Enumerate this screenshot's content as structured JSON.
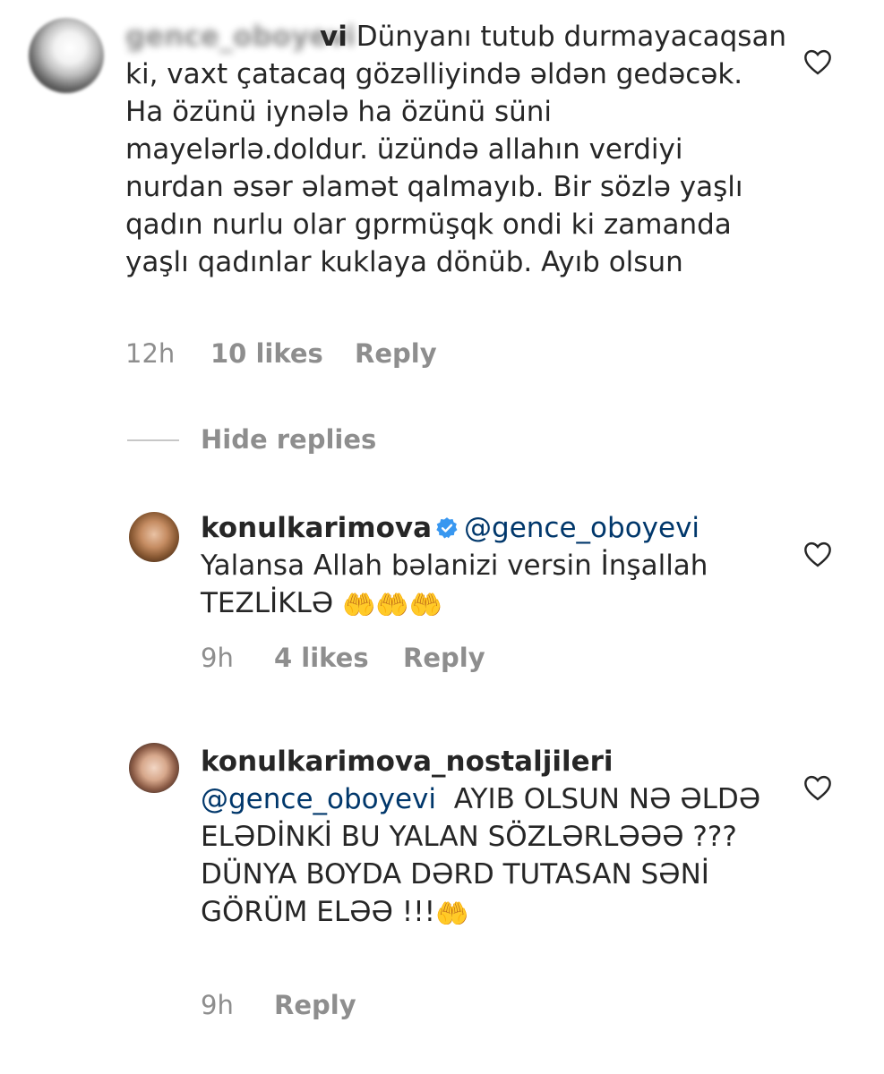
{
  "comments": [
    {
      "username": "gence_oboyevi",
      "username_visible_part": "vi",
      "text": "Dünyanı tutub durmayacaqsan ki, vaxt çatacaq gözəlliyində əldən gedəcək. Ha özünü iynələ ha özünü süni mayelərlə.doldur. üzündə allahın verdiyi nurdan əsər əlamət qalmayıb. Bir sözlə yaşlı qadın nurlu olar gprmüşqk ondi ki zamanda yaşlı qadınlar kuklaya dönüb. Ayıb olsun",
      "time": "12h",
      "likes": "10 likes",
      "reply_label": "Reply"
    }
  ],
  "hide_replies_label": "Hide replies",
  "replies": [
    {
      "username": "konulkarimova",
      "verified": true,
      "mention": "@gence_oboyevi",
      "text": "Yalansa Allah bəlanizi versin İnşallah TEZLİKLƏ",
      "emoji": "🤲🤲🤲",
      "time": "9h",
      "likes": "4 likes",
      "reply_label": "Reply"
    },
    {
      "username": "konulkarimova_nostaljileri",
      "verified": false,
      "mention": "@gence_oboyevi",
      "text": "AYIB OLSUN NƏ ƏLDƏ ELƏDİNKİ BU YALAN SÖZLƏRLƏƏƏ ??? DÜNYA BOYDA DƏRD TUTASAN SƏNİ GÖRÜM ELƏƏ !!!",
      "emoji": "🤲",
      "time": "9h",
      "reply_label": "Reply"
    }
  ],
  "colors": {
    "text": "#262626",
    "meta": "#8e8e8e",
    "mention": "#00376b",
    "verified": "#3897f0"
  },
  "icons": {
    "like": "heart-outline-icon",
    "verified": "verified-badge-icon"
  }
}
